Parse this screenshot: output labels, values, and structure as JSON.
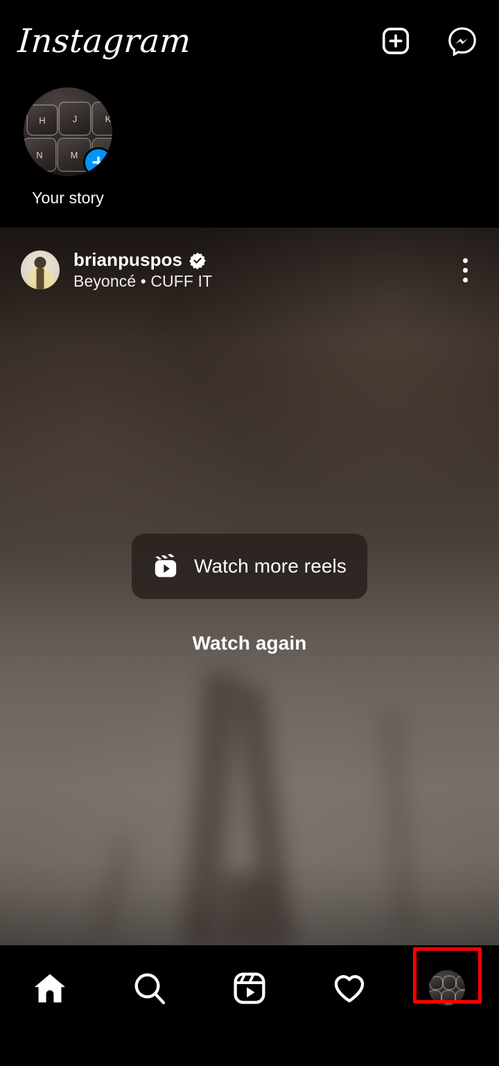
{
  "app": {
    "name": "Instagram",
    "logo_text": "Instagram"
  },
  "header": {
    "add_post": {
      "label": "New post",
      "icon": "plus-square-icon"
    },
    "messenger": {
      "label": "Messenger",
      "icon": "messenger-icon"
    }
  },
  "stories": {
    "items": [
      {
        "label": "Your story",
        "has_add_badge": true,
        "badge_icon": "plus-icon",
        "badge_color": "#0095F6",
        "thumbnail": "keyboard-closeup",
        "thumbnail_keys": [
          "H",
          "J",
          "K",
          "N",
          "M",
          "<"
        ]
      }
    ]
  },
  "post": {
    "username": "brianpuspos",
    "verified": true,
    "verified_icon": "verified-badge-icon",
    "audio": "Beyoncé • CUFF IT",
    "more_options_icon": "three-dots-vertical-icon",
    "avatar": "user-portrait",
    "media_type": "video",
    "overlay": {
      "watch_more_label": "Watch more reels",
      "watch_more_icon": "reels-icon",
      "watch_again_label": "Watch again"
    }
  },
  "bottom_nav": {
    "items": [
      {
        "label": "Home",
        "icon": "home-icon",
        "active": true
      },
      {
        "label": "Search",
        "icon": "search-icon",
        "active": false
      },
      {
        "label": "Reels",
        "icon": "reels-icon",
        "active": false
      },
      {
        "label": "Notifications",
        "icon": "heart-icon",
        "active": false
      },
      {
        "label": "Profile",
        "icon": "profile-avatar-icon",
        "active": false,
        "highlighted": true
      }
    ]
  },
  "annotation": {
    "type": "highlight-rectangle",
    "color": "#FF0000",
    "target": "profile-tab"
  }
}
